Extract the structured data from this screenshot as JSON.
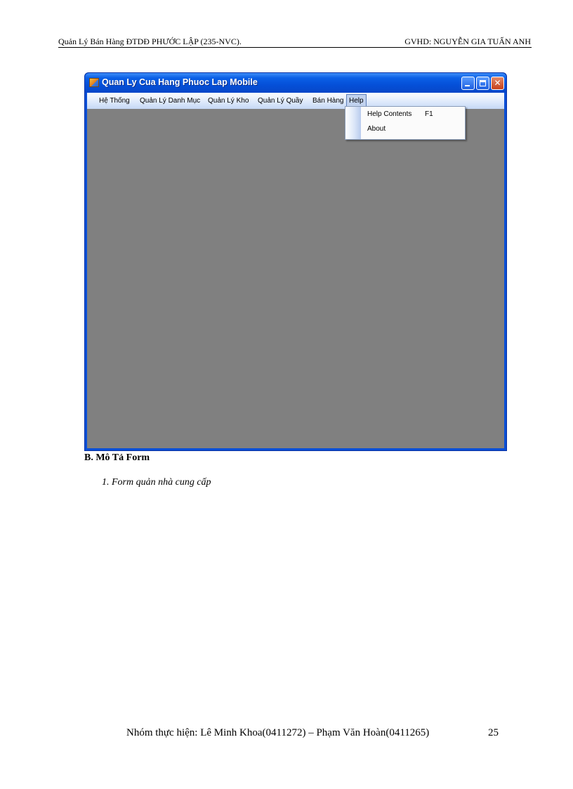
{
  "header": {
    "left": "Quản Lý Bán Hàng ĐTDĐ  PHƯỚC  LẬP (235-NVC).",
    "right": "GVHD:  NGUYỄN   GIA TUẤN ANH"
  },
  "window": {
    "title": "Quan Ly Cua Hang Phuoc Lap Mobile",
    "menu": [
      "Hệ Thống",
      "Quản Lý Danh Mục",
      "Quản Lý Kho",
      "Quản Lý Quầy",
      "Bán Hàng",
      "Help"
    ],
    "active_menu": "Help",
    "dropdown": {
      "items": [
        {
          "label": "Help Contents",
          "shortcut": "F1"
        },
        {
          "label": "About",
          "shortcut": ""
        }
      ]
    },
    "colors": {
      "titlebar": "#0a5fe6",
      "client": "#808080",
      "menubar": "#dce8fb"
    }
  },
  "doc": {
    "section_b": "B. Mô Tả Form",
    "item_1": "1. Form quản nhà cung cấp"
  },
  "footer": {
    "text": "Nhóm thực hiện:  Lê Minh  Khoa(0411272) – Phạm  Văn Hoàn(0411265)",
    "page": "25"
  }
}
